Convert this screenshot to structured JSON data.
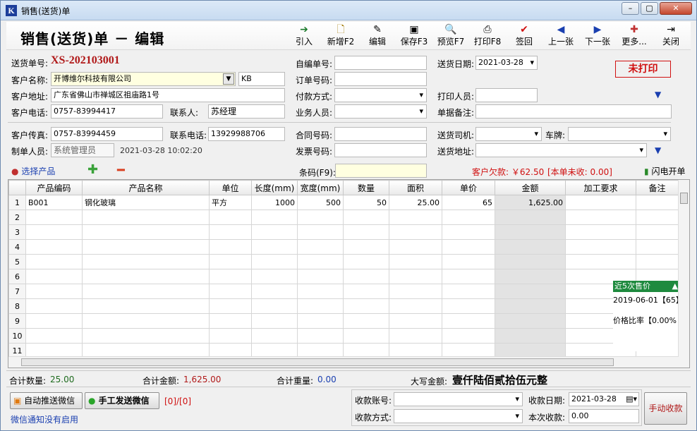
{
  "window": {
    "title": "销售(送货)单",
    "app_icon": "K"
  },
  "header": {
    "title": "销售(送货)单 － 编辑"
  },
  "toolbar": [
    {
      "label": "引入",
      "icon": "arrow-right-icon"
    },
    {
      "label": "新增F2",
      "icon": "new-doc-icon"
    },
    {
      "label": "编辑",
      "icon": "edit-doc-icon"
    },
    {
      "label": "保存F3",
      "icon": "save-icon"
    },
    {
      "label": "预览F7",
      "icon": "preview-icon"
    },
    {
      "label": "打印F8",
      "icon": "print-icon"
    },
    {
      "label": "签回",
      "icon": "check-icon"
    },
    {
      "label": "上一张",
      "icon": "prev-icon"
    },
    {
      "label": "下一张",
      "icon": "next-icon"
    },
    {
      "label": "更多...",
      "icon": "more-icon"
    },
    {
      "label": "关闭",
      "icon": "close-door-icon"
    }
  ],
  "form": {
    "order_no_label": "送货单号:",
    "order_no": "XS-202103001",
    "self_no_label": "自编单号:",
    "self_no": "",
    "date_label": "送货日期:",
    "date": "2021-03-28",
    "status": "未打印",
    "customer_label": "客户名称:",
    "customer": "开博维尔科技有限公司",
    "customer_code": "KB",
    "ordernum_label": "订单号码:",
    "ordernum": "",
    "address_label": "客户地址:",
    "address": "广东省佛山市禅城区祖庙路1号",
    "payment_label": "付款方式:",
    "payment": "",
    "printer_label": "打印人员:",
    "printer": "",
    "phone_label": "客户电话:",
    "phone": "0757-83994417",
    "contact_label": "联系人:",
    "contact": "苏经理",
    "salesman_label": "业务人员:",
    "salesman": "",
    "remark_label": "单据备注:",
    "remark": "",
    "fax_label": "客户传真:",
    "fax": "0757-83994459",
    "contact_phone_label": "联系电话:",
    "contact_phone": "13929988706",
    "contract_label": "合同号码:",
    "contract": "",
    "driver_label": "送货司机:",
    "driver": "",
    "plate_label": "车牌:",
    "plate": "",
    "creator_label": "制单人员:",
    "creator": "系统管理员",
    "created_at": "2021-03-28 10:02:20",
    "invoice_label": "发票号码:",
    "invoice": "",
    "ship_addr_label": "送货地址:",
    "ship_addr": ""
  },
  "product_bar": {
    "select_label": "选择产品",
    "barcode_label": "条码(F9):",
    "barcode": "",
    "debt_text": "客户欠款: ￥62.50",
    "unpaid_text": "[本单未收: 0.00]",
    "flash_label": "闪电开单"
  },
  "table": {
    "columns": [
      "",
      "产品编码",
      "产品名称",
      "单位",
      "长度(mm)",
      "宽度(mm)",
      "数量",
      "面积",
      "单价",
      "金额",
      "加工要求",
      "备注"
    ],
    "rows": [
      [
        "1",
        "B001",
        "钢化玻璃",
        "平方",
        "1000",
        "500",
        "50",
        "25.00",
        "65",
        "1,625.00",
        "",
        ""
      ],
      [
        "2",
        "",
        "",
        "",
        "",
        "",
        "",
        "",
        "",
        "",
        "",
        ""
      ],
      [
        "3",
        "",
        "",
        "",
        "",
        "",
        "",
        "",
        "",
        "",
        "",
        ""
      ],
      [
        "4",
        "",
        "",
        "",
        "",
        "",
        "",
        "",
        "",
        "",
        "",
        ""
      ],
      [
        "5",
        "",
        "",
        "",
        "",
        "",
        "",
        "",
        "",
        "",
        "",
        ""
      ],
      [
        "6",
        "",
        "",
        "",
        "",
        "",
        "",
        "",
        "",
        "",
        "",
        ""
      ],
      [
        "7",
        "",
        "",
        "",
        "",
        "",
        "",
        "",
        "",
        "",
        "",
        ""
      ],
      [
        "8",
        "",
        "",
        "",
        "",
        "",
        "",
        "",
        "",
        "",
        "",
        ""
      ],
      [
        "9",
        "",
        "",
        "",
        "",
        "",
        "",
        "",
        "",
        "",
        "",
        ""
      ],
      [
        "10",
        "",
        "",
        "",
        "",
        "",
        "",
        "",
        "",
        "",
        "",
        ""
      ],
      [
        "11",
        "",
        "",
        "",
        "",
        "",
        "",
        "",
        "",
        "",
        "",
        ""
      ]
    ]
  },
  "price_popup": {
    "title": "近5次售价",
    "entry": "2019-06-01【65】",
    "ratio": "价格比率【0.00%"
  },
  "summary": {
    "qty_label": "合计数量:",
    "qty": "25.00",
    "amount_label": "合计金额:",
    "amount": "1,625.00",
    "weight_label": "合计重量:",
    "weight": "0.00",
    "caps_label": "大写金额:",
    "caps": "壹仟陆佰贰拾伍元整"
  },
  "footer": {
    "auto_wechat": "自动推送微信",
    "manual_wechat": "手工发送微信",
    "counter": "[0]/[0]",
    "notice": "微信通知没有启用",
    "account_label": "收款账号:",
    "account": "",
    "collect_date_label": "收款日期:",
    "collect_date": "2021-03-28",
    "method_label": "收款方式:",
    "method": "",
    "this_label": "本次收款:",
    "this_amount": "0.00",
    "manual_collect": "手动收款"
  },
  "colors": {
    "accent_red": "#d01010",
    "order_no": "#b01818",
    "link_blue": "#1a3fb0",
    "popup_green": "#1e8a3e"
  }
}
